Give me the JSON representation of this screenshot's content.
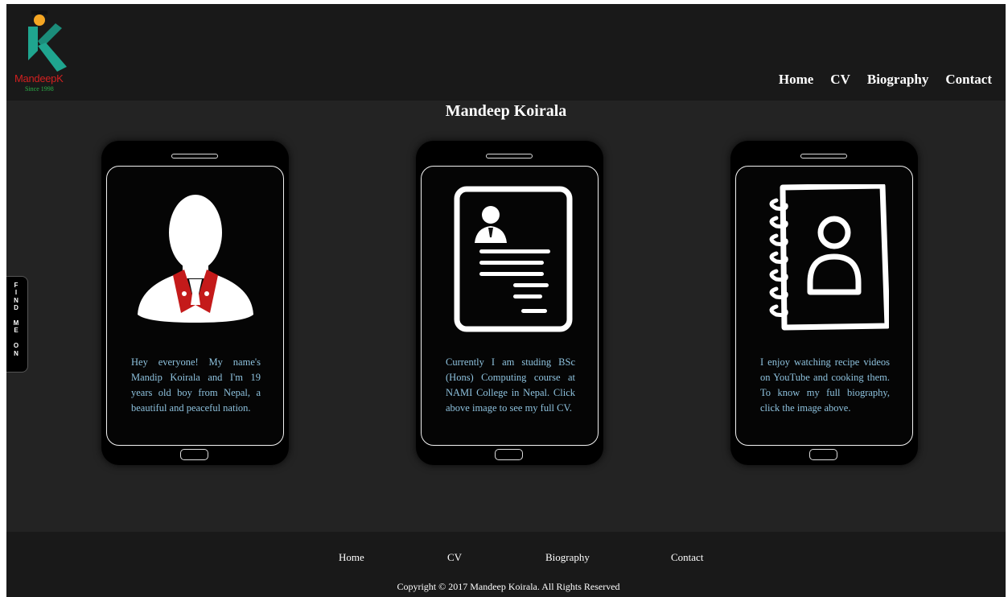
{
  "brand": {
    "name": "MandeepK",
    "since": "Since 1998",
    "colors": {
      "name": "#d02020",
      "since": "#2cb14a",
      "logo_k": "#1fa58f",
      "logo_head": "#f5a623"
    }
  },
  "nav": {
    "items": [
      {
        "label": "Home"
      },
      {
        "label": "CV"
      },
      {
        "label": "Biography"
      },
      {
        "label": "Contact"
      }
    ]
  },
  "page_title": "Mandeep Koirala",
  "side_tab": {
    "label": "FIND ME ON"
  },
  "cards": [
    {
      "icon": "profile-avatar-icon",
      "text": "Hey everyone! My name's Mandip Koirala and I'm 19 years old boy from Nepal, a beautiful and peaceful nation."
    },
    {
      "icon": "cv-document-icon",
      "text": "Currently I am studing BSc (Hons) Computing course at NAMI College in Nepal. Click above image to see my full CV."
    },
    {
      "icon": "contact-book-icon",
      "text": "I enjoy watching recipe videos on YouTube and cooking them. To know my full biography, click the image above."
    }
  ],
  "footer": {
    "links": [
      {
        "label": "Home"
      },
      {
        "label": "CV"
      },
      {
        "label": "Biography"
      },
      {
        "label": "Contact"
      }
    ],
    "copyright": "Copyright © 2017 Mandeep Koirala. All Rights Reserved"
  },
  "theme": {
    "background": "#232323",
    "header": "#191919",
    "card_text": "#8ec2de",
    "accent_red": "#c41a1a"
  }
}
